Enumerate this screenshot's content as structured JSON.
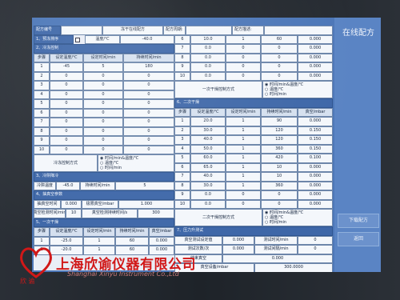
{
  "window_title": "在线配方",
  "header": {
    "recipe_no_label": "配方编号",
    "recipe_name": "冻干在线配方",
    "recipe_period_label": "配方周期:",
    "recipe_desc_label": "配方描述:"
  },
  "pre": {
    "s1": "1、预冻排序",
    "temp_label": "温度/℃",
    "temp_value": "-40.0",
    "s2": "2、冷冻控制",
    "headers": [
      "步骤",
      "设定温度/℃",
      "设定时间/min",
      "持续时间/min"
    ],
    "rows": [
      [
        "1",
        "-45",
        "5",
        "180"
      ],
      [
        "2",
        "0",
        "0",
        "0"
      ],
      [
        "3",
        "0",
        "0",
        "0"
      ],
      [
        "4",
        "0",
        "0",
        "0"
      ],
      [
        "5",
        "0",
        "0",
        "0"
      ],
      [
        "6",
        "0",
        "0",
        "0"
      ],
      [
        "7",
        "0",
        "0",
        "0"
      ],
      [
        "8",
        "0",
        "0",
        "0"
      ],
      [
        "9",
        "0",
        "0",
        "0"
      ],
      [
        "10",
        "0",
        "0",
        "0"
      ]
    ],
    "mode_label": "冷冻控制方式",
    "mode_options": [
      "时间/min&温度/℃",
      "温度/℃",
      "时间/min"
    ]
  },
  "primary": {
    "rows": [
      [
        "6",
        "10.0",
        "1",
        "60",
        "0.000"
      ],
      [
        "7",
        "0.0",
        "0",
        "0",
        "0.000"
      ],
      [
        "8",
        "0.0",
        "0",
        "0",
        "0.000"
      ],
      [
        "9",
        "0.0",
        "0",
        "0",
        "0.000"
      ],
      [
        "10",
        "0.0",
        "0",
        "0",
        "0.000"
      ]
    ],
    "mode_label": "一次干燥控制方式",
    "mode_options": [
      "时间/min&温度/℃",
      "温度/℃",
      "时间/min"
    ]
  },
  "secondary": {
    "section": "6、二次干燥",
    "headers": [
      "步骤",
      "设定温度/℃",
      "设定时间/min",
      "持续时间/min",
      "真空/mbar"
    ],
    "rows": [
      [
        "1",
        "20.0",
        "1",
        "90",
        "0.000"
      ],
      [
        "2",
        "30.0",
        "1",
        "120",
        "0.150"
      ],
      [
        "3",
        "40.0",
        "1",
        "120",
        "0.150"
      ],
      [
        "4",
        "50.0",
        "1",
        "360",
        "0.150"
      ],
      [
        "5",
        "60.0",
        "1",
        "420",
        "0.100"
      ],
      [
        "6",
        "65.0",
        "1",
        "10",
        "0.000"
      ],
      [
        "7",
        "40.0",
        "1",
        "10",
        "0.000"
      ],
      [
        "8",
        "30.0",
        "1",
        "360",
        "0.000"
      ],
      [
        "9",
        "0.0",
        "0",
        "0",
        "0.000"
      ],
      [
        "10",
        "0.0",
        "0",
        "0",
        "0.000"
      ]
    ],
    "mode_label": "二次干燥控制方式",
    "mode_options": [
      "时间/min&温度/℃",
      "温度/℃",
      "时间/min"
    ]
  },
  "trap": {
    "section": "3、冷阱降冷",
    "temp_label": "冷阱温度",
    "temp_value": "-45.0",
    "hold_label": "持续时间/min",
    "hold_value": "5"
  },
  "vacuum": {
    "section": "4、抽真空参数",
    "leak_label": "抽真空时间",
    "leak_value": "0.000",
    "leak_rate_label": "极限真空/mbar",
    "leak_rate_value": "1.000",
    "p1_label": "真空检测时间/min",
    "p1_value": "10",
    "p2_label": "真空检测持续时间/s",
    "p2_value": "300"
  },
  "first_dry": {
    "section": "5、一次干燥",
    "headers": [
      "步骤",
      "设定温度/℃",
      "设定时间/min",
      "持续时间/min",
      "真空/mbar"
    ],
    "rows": [
      [
        "1",
        "-25.0",
        "1",
        "60",
        "0.000"
      ],
      [
        "2",
        "-20.0",
        "1",
        "60",
        "0.000"
      ]
    ]
  },
  "pressure": {
    "section": "7、压力升测试",
    "check_label": "真空测试设定值",
    "check_value": "0.000",
    "rise_label": "测试时间/min",
    "rise_value": "0",
    "rate_label": "测试次数/次",
    "rate_value": "0.000",
    "count_label": "测试间隔/min",
    "count_value": "0",
    "end_label": "结束真空",
    "end_value": "0.000",
    "final_label": "真空设备/mbar",
    "final_value": "300.0000"
  },
  "top_row": {
    "r1": [
      "6",
      "10.0",
      "1",
      "60",
      "0.000"
    ]
  },
  "right_buttons": [
    "下载配方",
    "返回"
  ],
  "logo": {
    "name": "上海欣谕仪器有限公司",
    "en": "Shanghai Xinyu Instrument Co.,Ltd",
    "brand": "欣 谕"
  }
}
